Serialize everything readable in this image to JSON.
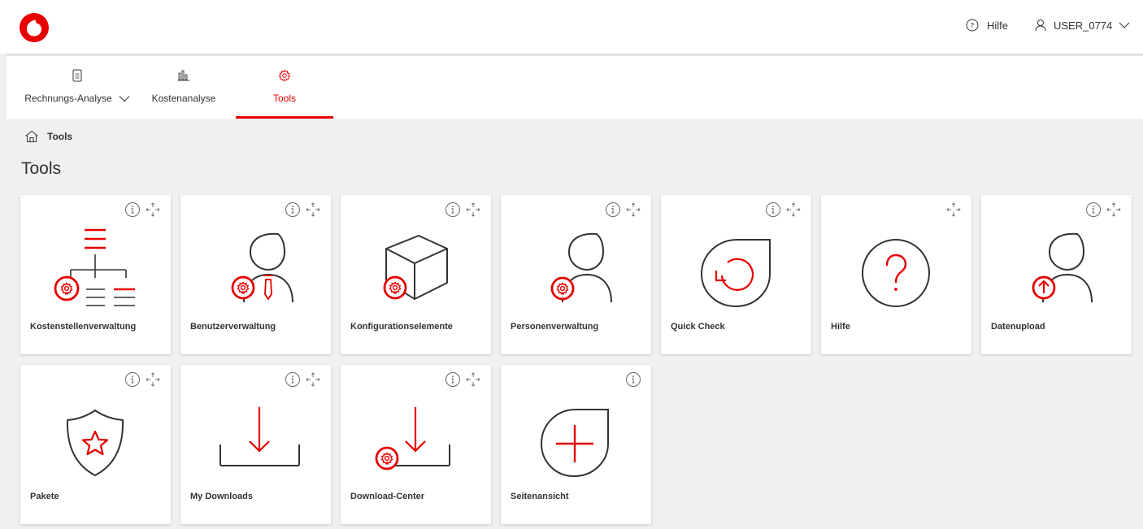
{
  "header": {
    "help_label": "Hilfe",
    "user_label": "USER_0774"
  },
  "nav": {
    "tabs": [
      {
        "label": "Rechnungs-Analyse",
        "icon": "invoice-icon",
        "has_dropdown": true,
        "active": false
      },
      {
        "label": "Kostenanalyse",
        "icon": "bar-chart-icon",
        "has_dropdown": false,
        "active": false
      },
      {
        "label": "Tools",
        "icon": "gear-icon",
        "has_dropdown": false,
        "active": true
      }
    ]
  },
  "breadcrumb": {
    "label": "Tools",
    "icon": "home-icon"
  },
  "page": {
    "title": "Tools"
  },
  "cards": [
    {
      "label": "Kostenstellenverwaltung",
      "icon": "cost-center-hierarchy-icon",
      "info": true,
      "move": true
    },
    {
      "label": "Benutzerverwaltung",
      "icon": "user-admin-icon",
      "info": true,
      "move": true
    },
    {
      "label": "Konfigurationselemente",
      "icon": "config-cube-icon",
      "info": true,
      "move": true
    },
    {
      "label": "Personenverwaltung",
      "icon": "person-admin-icon",
      "info": true,
      "move": true
    },
    {
      "label": "Quick Check",
      "icon": "refresh-icon",
      "info": true,
      "move": true
    },
    {
      "label": "Hilfe",
      "icon": "help-question-icon",
      "info": false,
      "move": true
    },
    {
      "label": "Datenupload",
      "icon": "upload-person-icon",
      "info": true,
      "move": true
    },
    {
      "label": "Pakete",
      "icon": "star-shield-icon",
      "info": true,
      "move": true
    },
    {
      "label": "My Downloads",
      "icon": "download-icon",
      "info": true,
      "move": true
    },
    {
      "label": "Download-Center",
      "icon": "download-center-icon",
      "info": true,
      "move": true
    },
    {
      "label": "Seitenansicht",
      "icon": "plus-drop-icon",
      "info": true,
      "move": false
    }
  ],
  "colors": {
    "accent": "#e60000",
    "text": "#333333",
    "background": "#f0f0f0",
    "card": "#ffffff"
  }
}
